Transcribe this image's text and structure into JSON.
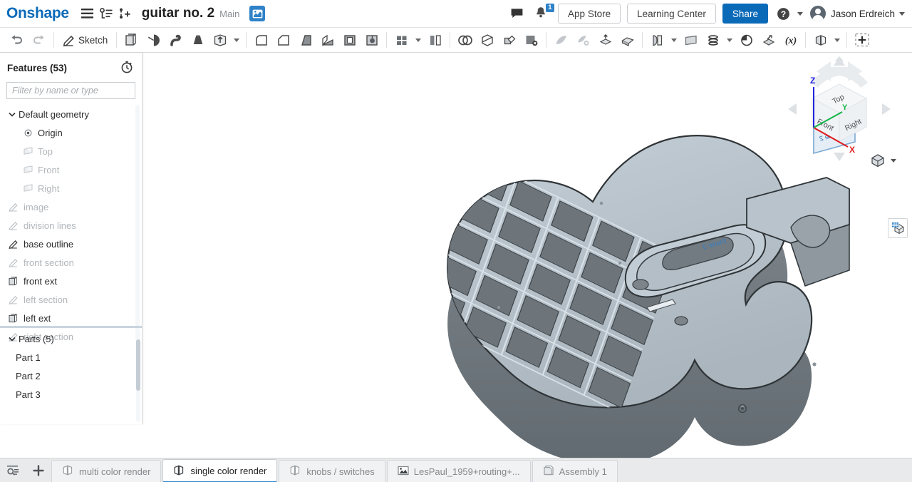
{
  "header": {
    "logo": "Onshape",
    "menu_icon": "hamburger-menu-icon",
    "versions_icon": "version-graph-icon",
    "branch_icon": "add-branch-icon",
    "doc_title": "guitar no. 2",
    "branch": "Main",
    "workspace_icon": "workspace-icon",
    "comment_icon": "comment-icon",
    "notification_icon": "bell-icon",
    "notification_count": "1",
    "app_store": "App Store",
    "learning_center": "Learning Center",
    "share": "Share",
    "help_icon": "help-circle-icon",
    "user_name": "Jason Erdreich",
    "avatar": "user-avatar",
    "accent_blue": "#0b6ab8"
  },
  "toolbar": {
    "undo": "undo-icon",
    "redo": "redo-icon",
    "sketch_label": "Sketch",
    "items": [
      "extrude-icon",
      "revolve-icon",
      "sweep-icon",
      "loft-icon",
      "thicken-icon",
      "fillet-icon",
      "chamfer-icon",
      "draft-icon",
      "rib-icon",
      "shell-icon",
      "hole-icon",
      "linear-pattern-icon",
      "mirror-icon",
      "boolean-icon",
      "split-icon",
      "transform-icon",
      "delete-part-icon",
      "fill-surface-icon",
      "delete-face-icon",
      "move-face-icon",
      "replace-face-icon",
      "surface-extrude-icon",
      "plane-icon",
      "helix-icon",
      "curve-pattern-icon",
      "sketch-derive-icon",
      "variable-icon",
      "assembly-feature-icon",
      "add-custom-feature-icon"
    ]
  },
  "features_panel": {
    "title": "Features (53)",
    "rollback_icon": "rollback-timer-icon",
    "filter_placeholder": "Filter by name or type",
    "filter_value": "",
    "tree": [
      {
        "label": "Default geometry",
        "icon": "chevron-down-icon",
        "type": "folder",
        "dim": false,
        "indent": 0
      },
      {
        "label": "Origin",
        "icon": "origin-icon",
        "type": "origin",
        "dim": false,
        "indent": 2
      },
      {
        "label": "Top",
        "icon": "plane-icon",
        "type": "plane",
        "dim": true,
        "indent": 2
      },
      {
        "label": "Front",
        "icon": "plane-icon",
        "type": "plane",
        "dim": true,
        "indent": 2
      },
      {
        "label": "Right",
        "icon": "plane-icon",
        "type": "plane",
        "dim": true,
        "indent": 2
      },
      {
        "label": "image",
        "icon": "sketch-icon",
        "type": "sketch",
        "dim": true,
        "indent": 0
      },
      {
        "label": "division lines",
        "icon": "sketch-icon",
        "type": "sketch",
        "dim": true,
        "indent": 0
      },
      {
        "label": "base outline",
        "icon": "sketch-icon",
        "type": "sketch",
        "dim": false,
        "indent": 0
      },
      {
        "label": "front section",
        "icon": "sketch-icon",
        "type": "sketch",
        "dim": true,
        "indent": 0
      },
      {
        "label": "front ext",
        "icon": "extrude-icon",
        "type": "extrude",
        "dim": false,
        "indent": 0
      },
      {
        "label": "left section",
        "icon": "sketch-icon",
        "type": "sketch",
        "dim": true,
        "indent": 0
      },
      {
        "label": "left ext",
        "icon": "extrude-icon",
        "type": "extrude",
        "dim": false,
        "indent": 0
      },
      {
        "label": "right section",
        "icon": "sketch-icon",
        "type": "sketch",
        "dim": true,
        "indent": 0
      }
    ]
  },
  "parts_panel": {
    "title": "Parts (5)",
    "chevron": "chevron-down-icon",
    "items": [
      {
        "label": "Part 1"
      },
      {
        "label": "Part 2"
      },
      {
        "label": "Part 3"
      }
    ]
  },
  "graphics": {
    "plane_labels": [
      "Plane 2",
      "Plane 3"
    ],
    "viewcube": {
      "faces": {
        "top": "Top",
        "front": "Front",
        "right": "Right"
      },
      "axes": {
        "x": "X",
        "y": "Y",
        "z": "Z"
      },
      "x_color": "#e01b1b",
      "y_color": "#16b54a",
      "z_color": "#2222dd",
      "view_dropdown_icon": "view-orientation-icon"
    },
    "appearance_icon": "appearance-panel-icon",
    "model_top_color": "#b6c0c8",
    "model_wall_color": "#6e767c",
    "model_dark_color": "#555d63"
  },
  "tabbar": {
    "search_icon": "tab-search-icon",
    "add_icon": "add-tab-icon",
    "tabs": [
      {
        "label": "multi color render",
        "icon": "part-studio-icon",
        "active": false
      },
      {
        "label": "single color render",
        "icon": "part-studio-icon",
        "active": true
      },
      {
        "label": "knobs / switches",
        "icon": "part-studio-icon",
        "active": false
      },
      {
        "label": "LesPaul_1959+routing+...",
        "icon": "image-icon",
        "active": false
      },
      {
        "label": "Assembly 1",
        "icon": "assembly-icon",
        "active": false
      }
    ]
  }
}
